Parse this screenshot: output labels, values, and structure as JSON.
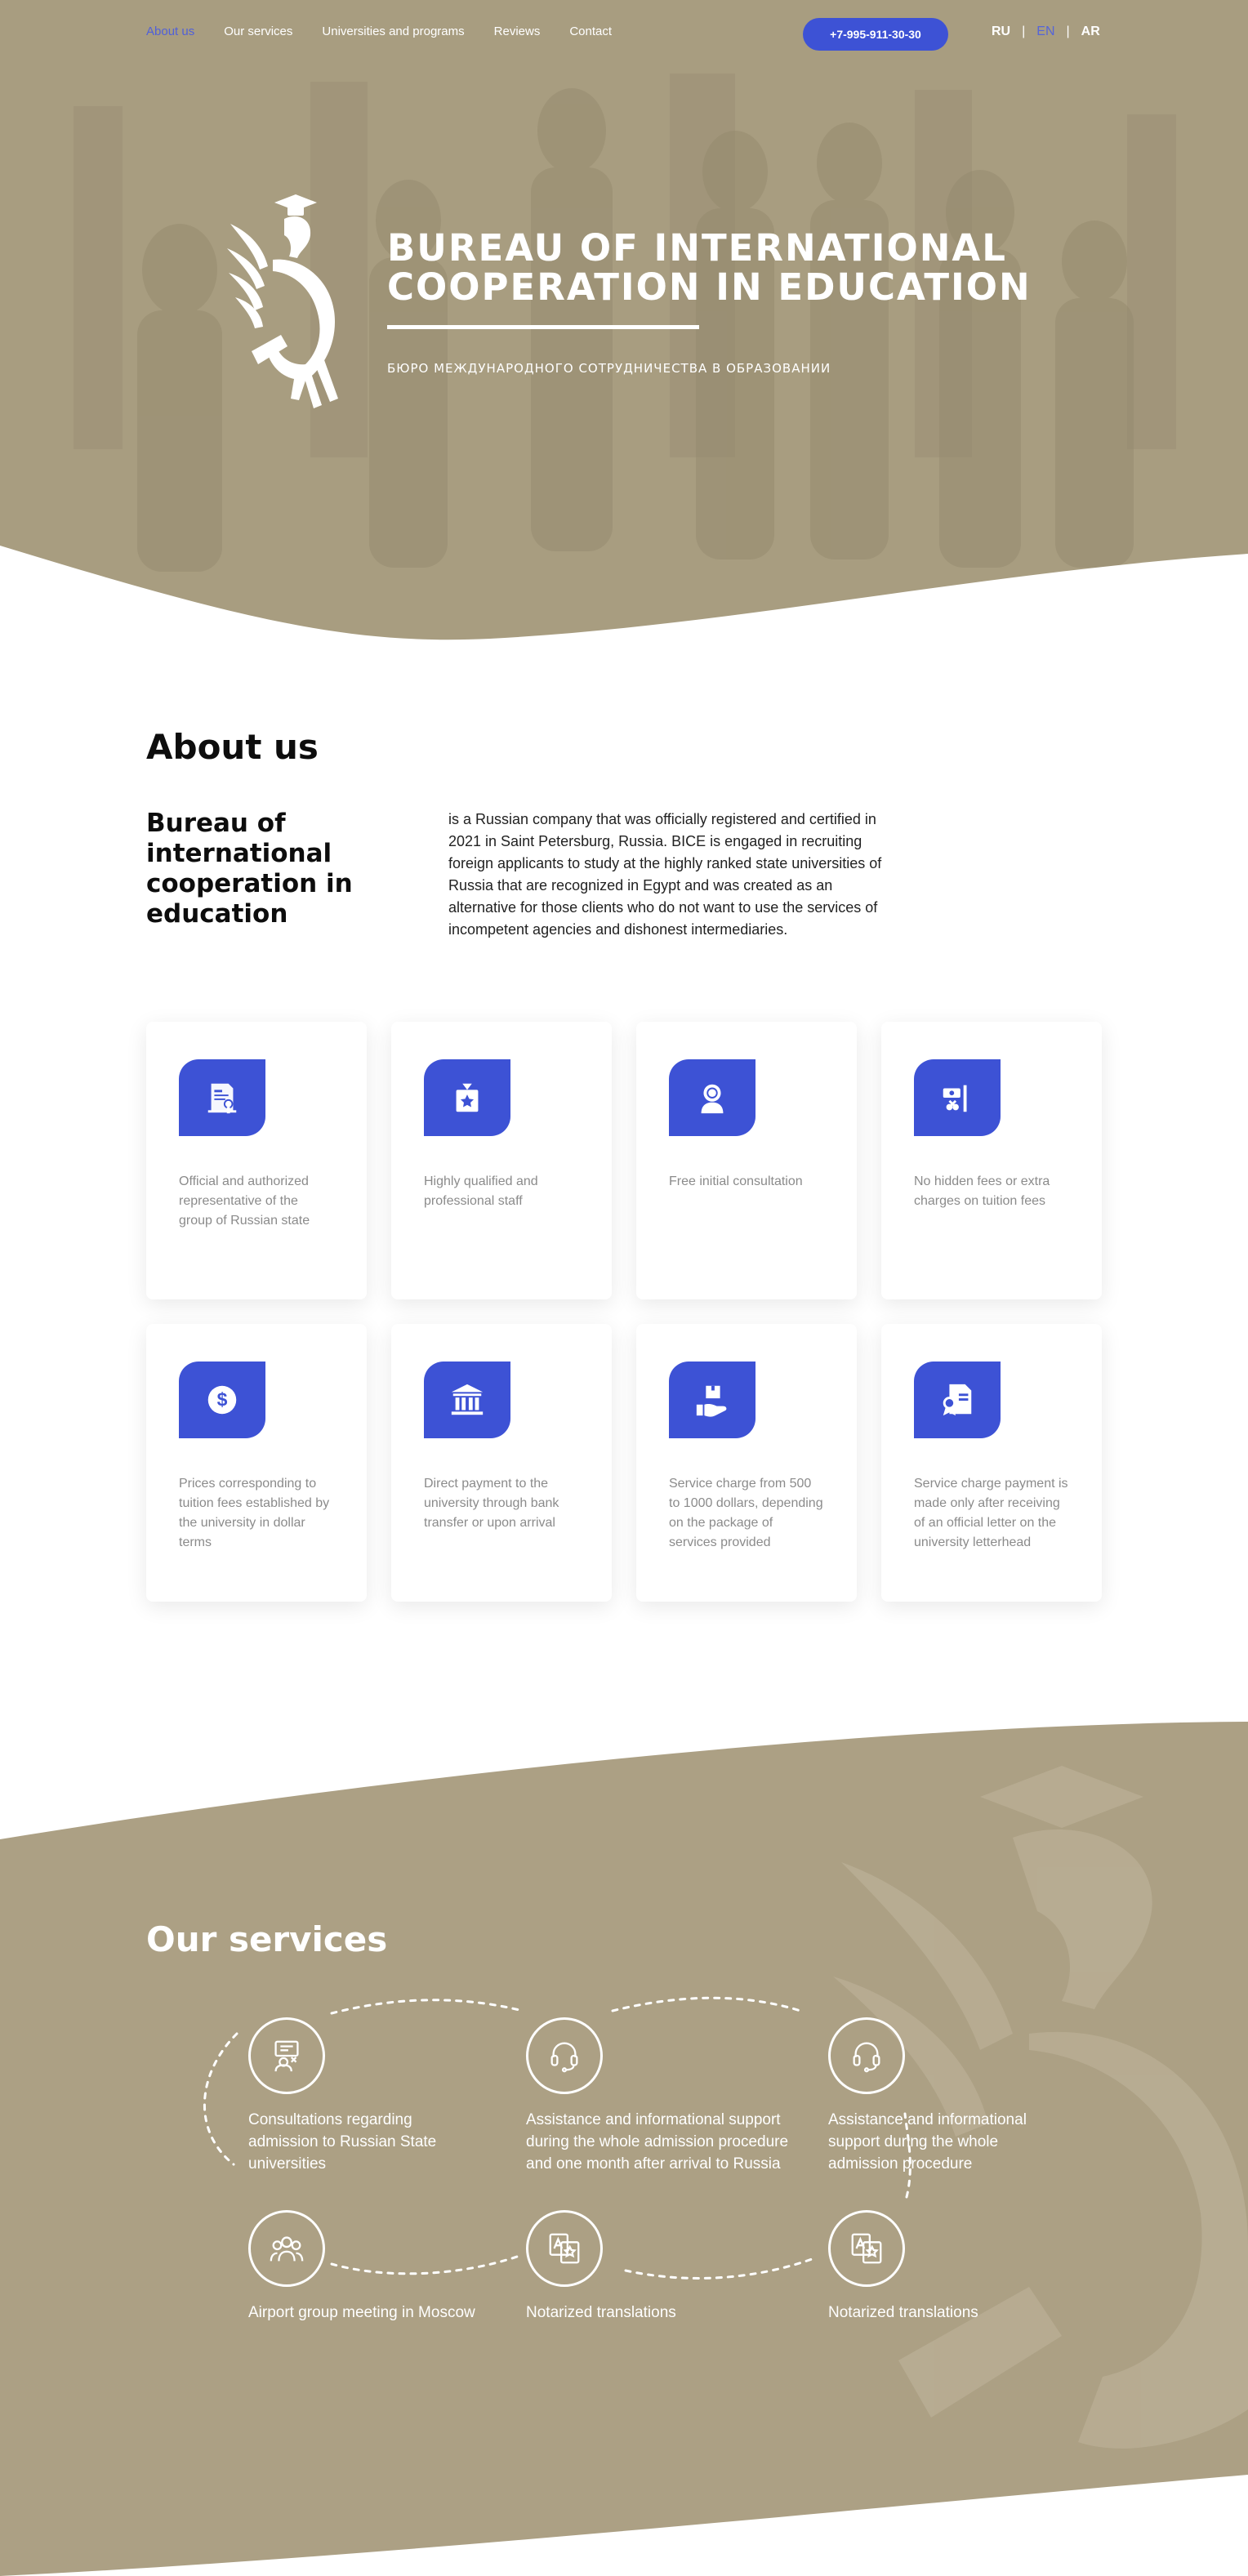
{
  "nav": {
    "links": [
      "About us",
      "Our services",
      "Universities and programs",
      "Reviews",
      "Contact"
    ],
    "phone": "+7-995-911-30-30",
    "langs": [
      "RU",
      "EN",
      "AR"
    ],
    "active_lang": "EN"
  },
  "hero": {
    "title_line1": "BUREAU OF INTERNATIONAL",
    "title_line2": "COOPERATION IN EDUCATION",
    "subtitle": "БЮРО МЕЖДУНАРОДНОГО СОТРУДНИЧЕСТВА В ОБРАЗОВАНИИ"
  },
  "about": {
    "title": "About us",
    "subtitle": "Bureau of international cooperation in education",
    "text": "is a Russian company that was officially registered and certified in 2021 in Saint Petersburg, Russia. BICE is engaged in recruiting foreign applicants to study at the highly ranked state universities of Russia that are recognized in Egypt and was created as an alternative for those clients who do not want to use the services of incompetent agencies and dishonest intermediaries.",
    "cards": [
      {
        "icon": "certificate-icon",
        "text": "Official and authorized representative of the group of Russian state"
      },
      {
        "icon": "award-box-icon",
        "text": "Highly qualified and professional staff"
      },
      {
        "icon": "support-agent-icon",
        "text": "Free initial consultation"
      },
      {
        "icon": "no-charges-icon",
        "text": "No hidden fees or extra charges on tuition fees"
      },
      {
        "icon": "dollar-coin-icon",
        "text": "Prices corresponding to tuition fees established by the university in dollar terms"
      },
      {
        "icon": "bank-building-icon",
        "text": "Direct payment to the university through bank transfer or upon arrival"
      },
      {
        "icon": "hand-package-icon",
        "text": "Service charge from 500 to 1000 dollars, depending on the package of services provided"
      },
      {
        "icon": "official-letter-icon",
        "text": "Service charge payment is made only after receiving of an official letter on the university letterhead"
      }
    ]
  },
  "services": {
    "title": "Our services",
    "items": [
      {
        "icon": "consultation-icon",
        "text": "Consultations regarding admission to Russian State universities"
      },
      {
        "icon": "headset-icon",
        "text": "Assistance and informational support during the whole admission procedure and one month after arrival to Russia"
      },
      {
        "icon": "headset-icon",
        "text": "Assistance and informational support during the whole admission procedure"
      },
      {
        "icon": "group-icon",
        "text": "Airport group meeting in Moscow"
      },
      {
        "icon": "translation-icon",
        "text": "Notarized translations"
      },
      {
        "icon": "translation-icon",
        "text": "Notarized translations"
      }
    ]
  },
  "colors": {
    "accent": "#3d52d5",
    "beige": "#aca084",
    "hero_overlay": "#a89d80"
  }
}
